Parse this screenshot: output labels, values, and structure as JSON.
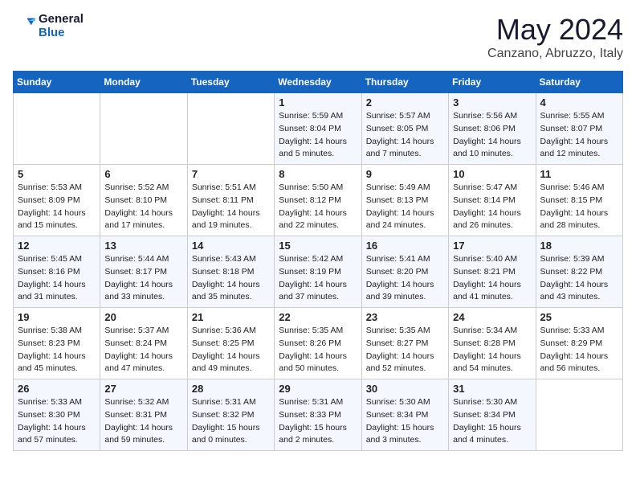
{
  "header": {
    "logo_general": "General",
    "logo_blue": "Blue",
    "month": "May 2024",
    "location": "Canzano, Abruzzo, Italy"
  },
  "weekdays": [
    "Sunday",
    "Monday",
    "Tuesday",
    "Wednesday",
    "Thursday",
    "Friday",
    "Saturday"
  ],
  "weeks": [
    [
      {
        "day": "",
        "info": ""
      },
      {
        "day": "",
        "info": ""
      },
      {
        "day": "",
        "info": ""
      },
      {
        "day": "1",
        "info": "Sunrise: 5:59 AM\nSunset: 8:04 PM\nDaylight: 14 hours\nand 5 minutes."
      },
      {
        "day": "2",
        "info": "Sunrise: 5:57 AM\nSunset: 8:05 PM\nDaylight: 14 hours\nand 7 minutes."
      },
      {
        "day": "3",
        "info": "Sunrise: 5:56 AM\nSunset: 8:06 PM\nDaylight: 14 hours\nand 10 minutes."
      },
      {
        "day": "4",
        "info": "Sunrise: 5:55 AM\nSunset: 8:07 PM\nDaylight: 14 hours\nand 12 minutes."
      }
    ],
    [
      {
        "day": "5",
        "info": "Sunrise: 5:53 AM\nSunset: 8:09 PM\nDaylight: 14 hours\nand 15 minutes."
      },
      {
        "day": "6",
        "info": "Sunrise: 5:52 AM\nSunset: 8:10 PM\nDaylight: 14 hours\nand 17 minutes."
      },
      {
        "day": "7",
        "info": "Sunrise: 5:51 AM\nSunset: 8:11 PM\nDaylight: 14 hours\nand 19 minutes."
      },
      {
        "day": "8",
        "info": "Sunrise: 5:50 AM\nSunset: 8:12 PM\nDaylight: 14 hours\nand 22 minutes."
      },
      {
        "day": "9",
        "info": "Sunrise: 5:49 AM\nSunset: 8:13 PM\nDaylight: 14 hours\nand 24 minutes."
      },
      {
        "day": "10",
        "info": "Sunrise: 5:47 AM\nSunset: 8:14 PM\nDaylight: 14 hours\nand 26 minutes."
      },
      {
        "day": "11",
        "info": "Sunrise: 5:46 AM\nSunset: 8:15 PM\nDaylight: 14 hours\nand 28 minutes."
      }
    ],
    [
      {
        "day": "12",
        "info": "Sunrise: 5:45 AM\nSunset: 8:16 PM\nDaylight: 14 hours\nand 31 minutes."
      },
      {
        "day": "13",
        "info": "Sunrise: 5:44 AM\nSunset: 8:17 PM\nDaylight: 14 hours\nand 33 minutes."
      },
      {
        "day": "14",
        "info": "Sunrise: 5:43 AM\nSunset: 8:18 PM\nDaylight: 14 hours\nand 35 minutes."
      },
      {
        "day": "15",
        "info": "Sunrise: 5:42 AM\nSunset: 8:19 PM\nDaylight: 14 hours\nand 37 minutes."
      },
      {
        "day": "16",
        "info": "Sunrise: 5:41 AM\nSunset: 8:20 PM\nDaylight: 14 hours\nand 39 minutes."
      },
      {
        "day": "17",
        "info": "Sunrise: 5:40 AM\nSunset: 8:21 PM\nDaylight: 14 hours\nand 41 minutes."
      },
      {
        "day": "18",
        "info": "Sunrise: 5:39 AM\nSunset: 8:22 PM\nDaylight: 14 hours\nand 43 minutes."
      }
    ],
    [
      {
        "day": "19",
        "info": "Sunrise: 5:38 AM\nSunset: 8:23 PM\nDaylight: 14 hours\nand 45 minutes."
      },
      {
        "day": "20",
        "info": "Sunrise: 5:37 AM\nSunset: 8:24 PM\nDaylight: 14 hours\nand 47 minutes."
      },
      {
        "day": "21",
        "info": "Sunrise: 5:36 AM\nSunset: 8:25 PM\nDaylight: 14 hours\nand 49 minutes."
      },
      {
        "day": "22",
        "info": "Sunrise: 5:35 AM\nSunset: 8:26 PM\nDaylight: 14 hours\nand 50 minutes."
      },
      {
        "day": "23",
        "info": "Sunrise: 5:35 AM\nSunset: 8:27 PM\nDaylight: 14 hours\nand 52 minutes."
      },
      {
        "day": "24",
        "info": "Sunrise: 5:34 AM\nSunset: 8:28 PM\nDaylight: 14 hours\nand 54 minutes."
      },
      {
        "day": "25",
        "info": "Sunrise: 5:33 AM\nSunset: 8:29 PM\nDaylight: 14 hours\nand 56 minutes."
      }
    ],
    [
      {
        "day": "26",
        "info": "Sunrise: 5:33 AM\nSunset: 8:30 PM\nDaylight: 14 hours\nand 57 minutes."
      },
      {
        "day": "27",
        "info": "Sunrise: 5:32 AM\nSunset: 8:31 PM\nDaylight: 14 hours\nand 59 minutes."
      },
      {
        "day": "28",
        "info": "Sunrise: 5:31 AM\nSunset: 8:32 PM\nDaylight: 15 hours\nand 0 minutes."
      },
      {
        "day": "29",
        "info": "Sunrise: 5:31 AM\nSunset: 8:33 PM\nDaylight: 15 hours\nand 2 minutes."
      },
      {
        "day": "30",
        "info": "Sunrise: 5:30 AM\nSunset: 8:34 PM\nDaylight: 15 hours\nand 3 minutes."
      },
      {
        "day": "31",
        "info": "Sunrise: 5:30 AM\nSunset: 8:34 PM\nDaylight: 15 hours\nand 4 minutes."
      },
      {
        "day": "",
        "info": ""
      }
    ]
  ]
}
